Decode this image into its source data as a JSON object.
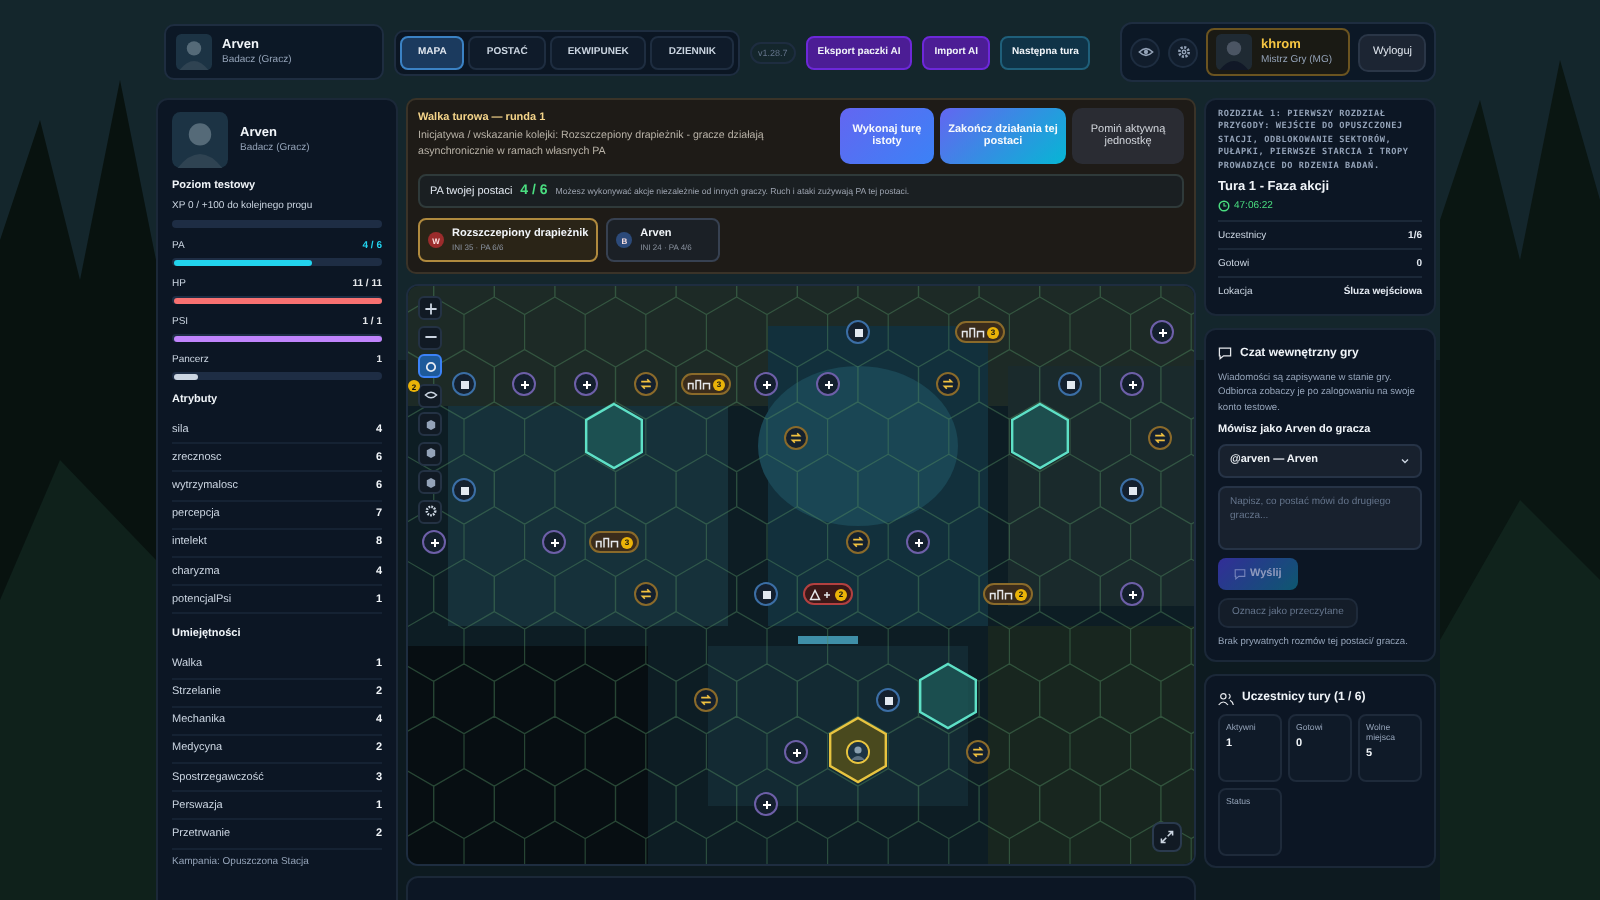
{
  "header": {
    "player": {
      "name": "Arven",
      "role": "Badacz (Gracz)"
    },
    "tabs": [
      {
        "label": "MAPA",
        "selected": true
      },
      {
        "label": "POSTAĆ",
        "selected": false
      },
      {
        "label": "EKWIPUNEK",
        "selected": false
      },
      {
        "label": "DZIENNIK",
        "selected": false
      }
    ],
    "version": "v1.28.7",
    "actions": [
      {
        "label": "Eksport paczki AI",
        "kind": "ai"
      },
      {
        "label": "Import AI",
        "kind": "ai"
      },
      {
        "label": "Następna tura",
        "kind": "turn"
      }
    ],
    "gm": {
      "name": "khrom",
      "role": "Mistrz Gry (MG)"
    },
    "logout": "Wyloguj"
  },
  "character": {
    "name": "Arven",
    "role": "Badacz (Gracz)",
    "level_title": "Poziom testowy",
    "xp": "XP 0 / +100 do kolejnego progu",
    "bars": [
      {
        "label": "PA",
        "value": "4 / 6",
        "level": 0.67,
        "color": "#22d3ee"
      },
      {
        "label": "HP",
        "value": "11 / 11",
        "level": 1,
        "color": "#f87171"
      },
      {
        "label": "PSI",
        "value": "1 / 1",
        "level": 1,
        "color": "#c084fc"
      },
      {
        "label": "Pancerz",
        "value": "1",
        "level": 0.12,
        "color": "#cbd5e1"
      }
    ],
    "attributes_title": "Atrybuty",
    "attributes": [
      {
        "label": "sila",
        "value": "4"
      },
      {
        "label": "zrecznosc",
        "value": "6"
      },
      {
        "label": "wytrzymalosc",
        "value": "6"
      },
      {
        "label": "percepcja",
        "value": "7"
      },
      {
        "label": "intelekt",
        "value": "8"
      },
      {
        "label": "charyzma",
        "value": "4"
      },
      {
        "label": "potencjalPsi",
        "value": "1"
      }
    ],
    "skills_title": "Umiejętności",
    "skills": [
      {
        "label": "Walka",
        "value": "1"
      },
      {
        "label": "Strzelanie",
        "value": "2"
      },
      {
        "label": "Mechanika",
        "value": "4"
      },
      {
        "label": "Medycyna",
        "value": "2"
      },
      {
        "label": "Spostrzegawczość",
        "value": "3"
      },
      {
        "label": "Perswazja",
        "value": "1"
      },
      {
        "label": "Przetrwanie",
        "value": "2"
      }
    ],
    "campaign": "Kampania: Opuszczona Stacja"
  },
  "combat": {
    "title": "Walka turowa — runda 1",
    "description": "Inicjatywa / wskazanie kolejki: Rozszczepiony drapieżnik - gracze działają asynchronicznie w ramach własnych PA",
    "buttons": [
      {
        "label": "Wykonaj turę istoty",
        "kind": "primary"
      },
      {
        "label": "Zakończ działania tej postaci",
        "kind": "accent"
      },
      {
        "label": "Pomiń aktywną jednostkę",
        "kind": "secondary"
      }
    ],
    "pa_label": "PA twojej postaci",
    "pa_value": "4 / 6",
    "pa_note": "Możesz wykonywać akcje niezależnie od innych graczy. Ruch i ataki zużywają PA tej postaci.",
    "queue": [
      {
        "initial": "W",
        "name": "Rozszczepiony drapieżnik",
        "stats": "INI 35 · PA 6/6",
        "selected": true,
        "color": "#9b2c2c"
      },
      {
        "initial": "B",
        "name": "Arven",
        "stats": "INI 24 · PA 4/6",
        "selected": false,
        "color": "#2c4a7a"
      }
    ]
  },
  "map": {
    "layer_badge": "2",
    "tools": [
      {
        "kind": "zoom-in",
        "selected": false
      },
      {
        "kind": "zoom-out",
        "selected": false
      },
      {
        "kind": "focus",
        "selected": true
      },
      {
        "kind": "vision",
        "selected": false
      },
      {
        "kind": "layer",
        "selected": false
      },
      {
        "kind": "layer",
        "selected": false
      },
      {
        "kind": "layer",
        "selected": false
      },
      {
        "kind": "settings",
        "selected": false
      }
    ],
    "markers": [
      {
        "kind": "crate"
      },
      {
        "kind": "group",
        "count": "3"
      },
      {
        "kind": "plus"
      },
      {
        "kind": "crate"
      },
      {
        "kind": "plus"
      },
      {
        "kind": "plus"
      },
      {
        "kind": "swap"
      },
      {
        "kind": "group",
        "count": "3"
      },
      {
        "kind": "plus"
      },
      {
        "kind": "plus"
      },
      {
        "kind": "swap"
      },
      {
        "kind": "crate"
      },
      {
        "kind": "plus"
      },
      {
        "kind": "swap"
      },
      {
        "kind": "swap"
      },
      {
        "kind": "crate"
      },
      {
        "kind": "crate"
      },
      {
        "kind": "plus"
      },
      {
        "kind": "plus"
      },
      {
        "kind": "group",
        "count": "3"
      },
      {
        "kind": "swap"
      },
      {
        "kind": "plus"
      },
      {
        "kind": "swap"
      },
      {
        "kind": "crate"
      },
      {
        "kind": "hazard",
        "count": "2"
      },
      {
        "kind": "group",
        "count": "2"
      },
      {
        "kind": "plus"
      },
      {
        "kind": "swap"
      },
      {
        "kind": "crate"
      },
      {
        "kind": "plus"
      },
      {
        "kind": "swap"
      },
      {
        "kind": "plus"
      },
      {
        "kind": "player"
      }
    ],
    "tiles": [
      {
        "kind": "passage"
      },
      {
        "kind": "passage"
      },
      {
        "kind": "passage"
      },
      {
        "kind": "active"
      }
    ]
  },
  "chapter": {
    "title": "ROZDZIAŁ 1: PIERWSZY ROZDZIAŁ PRZYGODY: WEJŚCIE DO OPUSZCZONEJ STACJI, ODBLOKOWANIE SEKTORÓW, PUŁAPKI, PIERWSZE STARCIA I TROPY PROWADZĄCE DO RDZENIA BADAŃ.",
    "turn": "Tura 1 - Faza akcji",
    "timer": "47:06:22",
    "stats": [
      {
        "label": "Uczestnicy",
        "value": "1/6"
      },
      {
        "label": "Gotowi",
        "value": "0"
      },
      {
        "label": "Lokacja",
        "value": "Śluza wejściowa"
      }
    ]
  },
  "chat": {
    "title": "Czat wewnętrzny gry",
    "info": "Wiadomości są zapisywane w stanie gry. Odbiorca zobaczy je po zalogowaniu na swoje konto testowe.",
    "speaking": "Mówisz jako Arven do gracza",
    "recipient": "@arven — Arven",
    "placeholder": "Napisz, co postać mówi do drugiego gracza...",
    "send": "Wyślij",
    "mark_read": "Oznacz jako przeczytane",
    "empty": "Brak prywatnych rozmów tej postaci/ gracza."
  },
  "participants": {
    "title": "Uczestnicy tury (1 / 6)",
    "stats": [
      {
        "label": "Aktywni",
        "value": "1"
      },
      {
        "label": "Gotowi",
        "value": "0"
      },
      {
        "label": "Wolne miejsca",
        "value": "5"
      },
      {
        "label": "Status"
      }
    ]
  }
}
